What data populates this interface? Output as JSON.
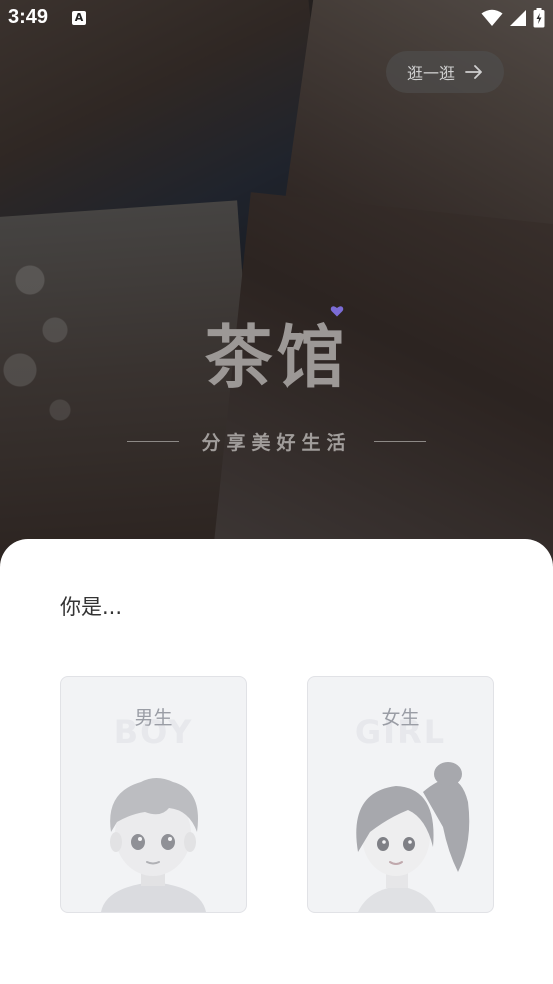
{
  "status_bar": {
    "time": "3:49",
    "notification_glyph": "A",
    "icons": [
      "wifi-icon",
      "signal-icon",
      "battery-charging-icon"
    ]
  },
  "header": {
    "browse_label": "逛一逛",
    "browse_icon": "arrow-right-icon"
  },
  "brand": {
    "title": "茶馆",
    "slogan": "分享美好生活"
  },
  "sheet": {
    "prompt": "你是...",
    "options": [
      {
        "label": "男生",
        "bg_word": "BOY",
        "illustration": "boy-avatar"
      },
      {
        "label": "女生",
        "bg_word": "GIRL",
        "illustration": "girl-avatar"
      }
    ]
  },
  "colors": {
    "overlay": "#141212",
    "sheet_bg": "#ffffff",
    "card_bg": "#f2f3f5",
    "card_border": "#e1e2e6",
    "brand_gray": "#9c9896",
    "heart_accent": "#7b6cd6"
  }
}
